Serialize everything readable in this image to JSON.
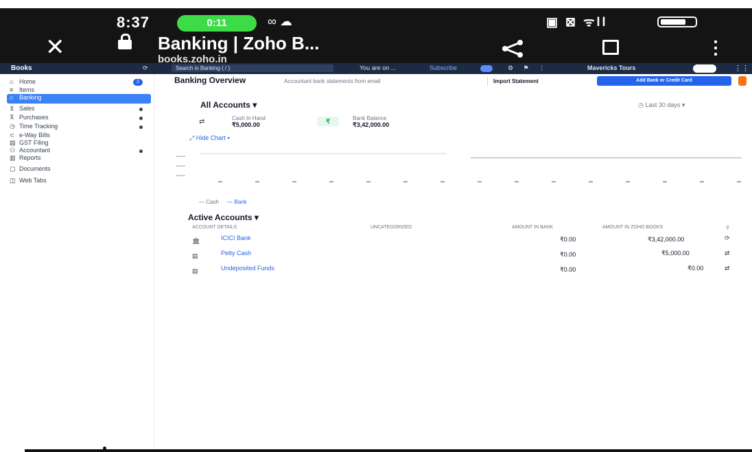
{
  "status_bar": {
    "time": "8:37",
    "call_pill": "0:11",
    "left_icons": "∞ ☁",
    "right_icons": "▣ ⊠ ᯤll",
    "battery_icon": "battery-icon"
  },
  "browser": {
    "close_icon": "✕",
    "title": "Banking | Zoho B...",
    "url": "books.zoho.in",
    "share_icon": "share-icon",
    "bookmark_icon": "bookmark-icon",
    "more_icon": "⋮"
  },
  "appbar": {
    "brand": "Books",
    "refresh": "⟳",
    "org_search": "Search in Banking ( / )",
    "trial_text": "You are on ...",
    "subscribe": "Subscribe",
    "icons": "⚙ ⚑ ⋮",
    "org_name": "Mavericks Tours",
    "apps_icon": "⋮⋮"
  },
  "sidebar": {
    "items": [
      {
        "icon": "⌂",
        "label": "Home",
        "badge": "2"
      },
      {
        "icon": "≡",
        "label": "Items"
      },
      {
        "icon": "⌂",
        "label": "Banking",
        "active": true
      },
      {
        "icon": "⊻",
        "label": "Sales"
      },
      {
        "icon": "⊼",
        "label": "Purchases"
      },
      {
        "icon": "◷",
        "label": "Time Tracking"
      },
      {
        "icon": "⊂",
        "label": "e-Way Bills"
      },
      {
        "icon": "▤",
        "label": "GST Filing"
      },
      {
        "icon": "⚇",
        "label": "Accountant"
      },
      {
        "icon": "▥",
        "label": "Reports"
      },
      {
        "icon": "▢",
        "label": "Documents"
      },
      {
        "icon": "◫",
        "label": "Web Tabs"
      }
    ]
  },
  "main": {
    "page_title": "Banking Overview",
    "sms_hint": "Accountant bank statements from email",
    "import_label": "Import Statement",
    "add_label": "Add Bank or Credit Card",
    "accounts_dropdown": "All Accounts ▾",
    "period": "◷ Last 30 days ▾",
    "stat1": {
      "icon": "⇄",
      "label": "Cash In Hand",
      "value": "₹5,000.00"
    },
    "stat2": {
      "icon": "₹",
      "label": "Bank Balance",
      "value": "₹3,42,000.00"
    },
    "hide_chart": "⤢ Hide Chart ▾",
    "legend_cash": "— Cash",
    "legend_bank": "— Bank",
    "active_title": "Active Accounts ▾",
    "table": {
      "headers": [
        "Account Details",
        "Uncategorized",
        "Amount in Bank",
        "Amount in Zoho Books",
        "⚲"
      ],
      "rows": [
        {
          "icon": "🏛",
          "name": "ICICI Bank",
          "uncategorized": "",
          "bank": "₹0.00",
          "books": "₹3,42,000.00",
          "action": "⟳"
        },
        {
          "icon": "▤",
          "name": "Petty Cash",
          "uncategorized": "",
          "bank": "₹0.00",
          "books": "₹5,000.00",
          "action": "⇄"
        },
        {
          "icon": "▤",
          "name": "Undeposited Funds",
          "uncategorized": "",
          "bank": "₹0.00",
          "books": "₹0.00",
          "action": "⇄"
        }
      ]
    }
  }
}
